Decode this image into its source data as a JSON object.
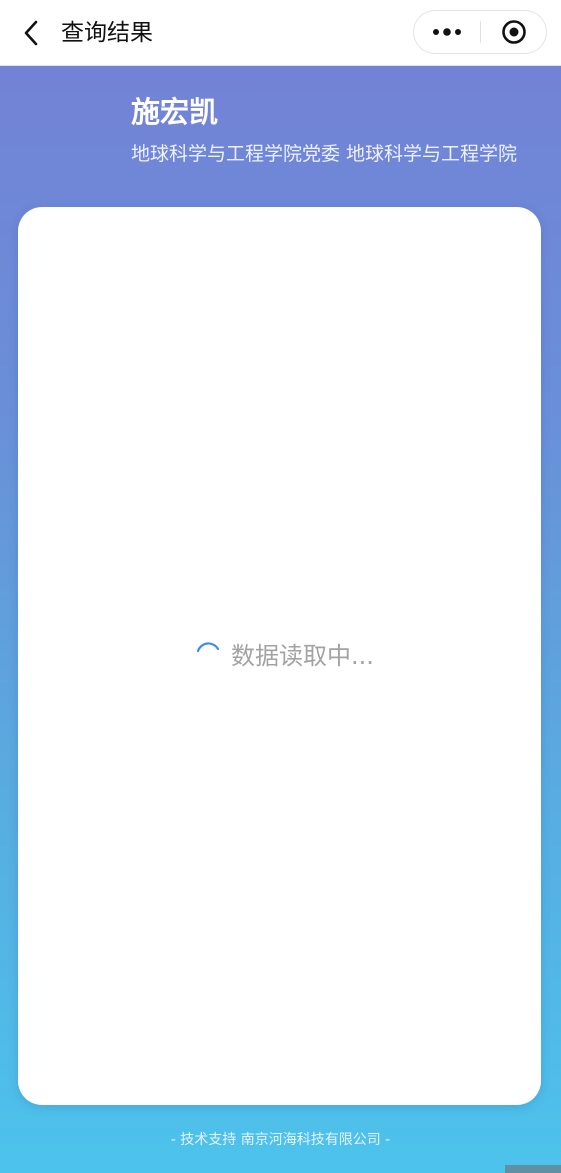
{
  "navbar": {
    "title": "查询结果",
    "back_icon": "chevron-left-icon",
    "more_icon": "more-dots-icon",
    "close_icon": "target-circle-icon"
  },
  "profile": {
    "name": "施宏凯",
    "department": "地球科学与工程学院党委 地球科学与工程学院"
  },
  "card": {
    "loading_text": "数据读取中..."
  },
  "footer": {
    "text": "- 技术支持 南京河海科技有限公司 -"
  },
  "colors": {
    "gradient_top": "#7480d6",
    "gradient_bottom": "#4cc3ec",
    "spinner": "#3a8ee6"
  }
}
